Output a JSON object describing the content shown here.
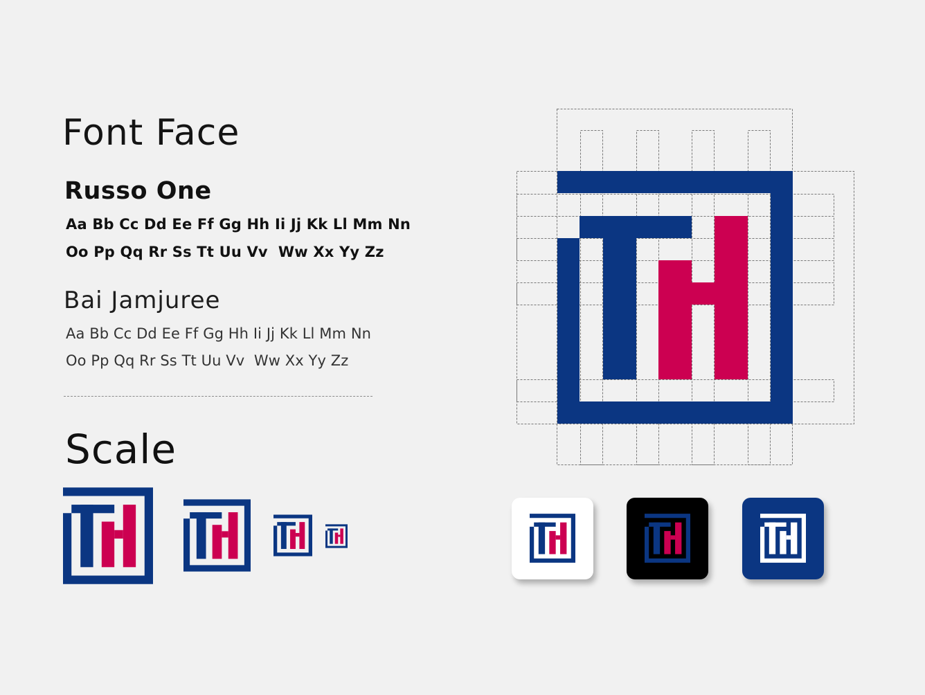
{
  "typography": {
    "section_title": "Font Face",
    "primary_font": {
      "name": "Russo One",
      "sample_line_1": "Aa Bb Cc Dd Ee Ff Gg Hh Ii Jj Kk Ll Mm Nn",
      "sample_line_2": "Oo Pp Qq Rr Ss Tt Uu Vv  Ww Xx Yy Zz"
    },
    "secondary_font": {
      "name": "Bai Jamjuree",
      "sample_line_1": "Aa Bb Cc Dd Ee Ff Gg Hh Ii Jj Kk Ll Mm Nn",
      "sample_line_2": "Oo Pp Qq Rr Ss Tt Uu Vv  Ww Xx Yy Zz"
    }
  },
  "scale": {
    "section_title": "Scale"
  },
  "logo": {
    "monogram": "TH",
    "colors": {
      "navy": "#0b3682",
      "crimson": "#cc0051",
      "white": "#ffffff",
      "black": "#000000",
      "background": "#f1f1f1"
    }
  },
  "app_icons": [
    {
      "variant": "light",
      "background": "#ffffff"
    },
    {
      "variant": "dark",
      "background": "#000000"
    },
    {
      "variant": "navy",
      "background": "#0b3682"
    }
  ]
}
